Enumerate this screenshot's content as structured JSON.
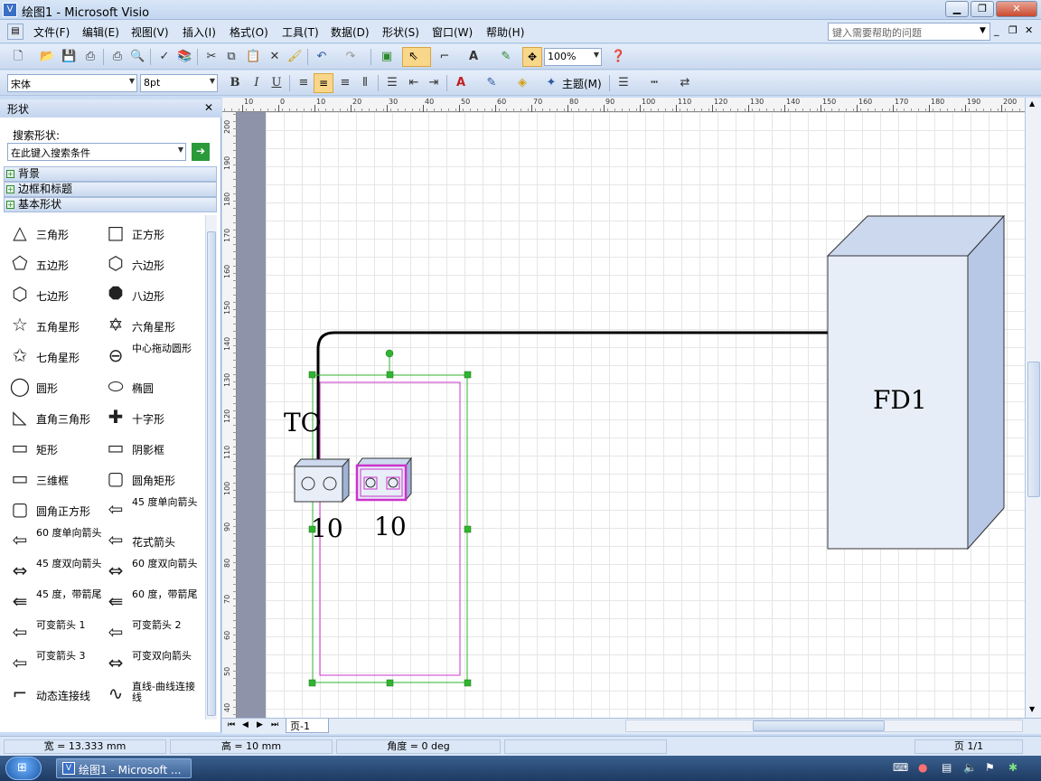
{
  "window": {
    "title": "绘图1 - Microsoft Visio"
  },
  "menu": [
    "文件(F)",
    "编辑(E)",
    "视图(V)",
    "插入(I)",
    "格式(O)",
    "工具(T)",
    "数据(D)",
    "形状(S)",
    "窗口(W)",
    "帮助(H)"
  ],
  "help_search": {
    "placeholder": "键入需要帮助的问题"
  },
  "toolbar": {
    "zoom": "100%",
    "theme_label": "主题(M)"
  },
  "format_toolbar": {
    "font": "宋体",
    "size": "8pt",
    "bold": "B",
    "italic": "I",
    "underline": "U"
  },
  "shapes_panel": {
    "title": "形状",
    "search_label": "搜索形状:",
    "search_placeholder": "在此键入搜索条件",
    "stencils": [
      "背景",
      "边框和标题",
      "基本形状"
    ],
    "shapes_left": [
      "三角形",
      "五边形",
      "七边形",
      "五角星形",
      "七角星形",
      "圆形",
      "直角三角形",
      "矩形",
      "三维框",
      "圆角正方形",
      "60 度单向箭头",
      "45 度双向箭头",
      "45 度，带箭尾",
      "可变箭头 1",
      "可变箭头 3",
      "动态连接线"
    ],
    "shapes_right": [
      "正方形",
      "六边形",
      "八边形",
      "六角星形",
      "中心拖动圆形",
      "椭圆",
      "十字形",
      "阴影框",
      "圆角矩形",
      "45 度单向箭头",
      "花式箭头",
      "60 度双向箭头",
      "60 度，带箭尾",
      "可变箭头 2",
      "可变双向箭头",
      "直线-曲线连接线"
    ]
  },
  "ruler": {
    "top": [
      "10",
      "0",
      "10",
      "20",
      "30",
      "40",
      "50",
      "60",
      "70",
      "80",
      "90",
      "100",
      "110",
      "120",
      "130",
      "140",
      "150",
      "160",
      "170",
      "180",
      "190",
      "200"
    ],
    "left": [
      "200",
      "190",
      "180",
      "170",
      "160",
      "150",
      "140",
      "130",
      "120",
      "110",
      "100",
      "90",
      "80",
      "70",
      "60",
      "50",
      "40"
    ]
  },
  "drawing": {
    "label_to": "TO",
    "label_10a": "10",
    "label_10b": "10",
    "fd1": "FD1"
  },
  "page_tab": "页-1",
  "status": {
    "width": "宽 = 13.333 mm",
    "height": "高 = 10 mm",
    "angle": "角度 = 0 deg",
    "page": "页 1/1"
  },
  "taskbar": {
    "task": "绘图1 - Microsoft ..."
  },
  "colors": {
    "selection": "#2fb52f",
    "magenta": "#cc33cc",
    "box_face": "#e8eef8",
    "box_side": "#b6c8e6"
  }
}
